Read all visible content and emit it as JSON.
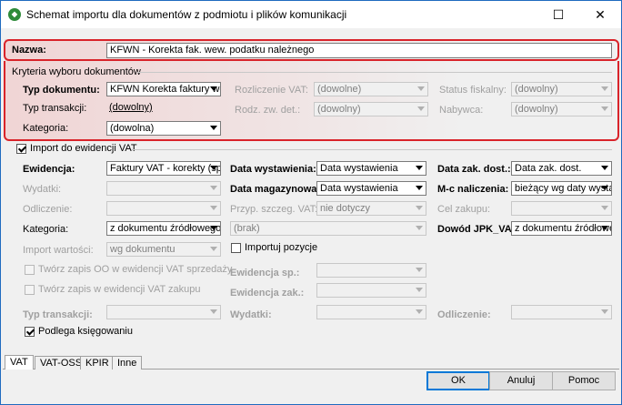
{
  "window": {
    "title": "Schemat importu dla dokumentów z podmiotu i plików komunikacji",
    "app_icon": "app-logo-icon"
  },
  "header": {
    "nazwa_label": "Nazwa:",
    "nazwa_value": "KFWN - Korekta fak. wew. podatku należnego"
  },
  "kryteria": {
    "section_label": "Kryteria wyboru dokumentów",
    "typ_dokumentu_label": "Typ dokumentu:",
    "typ_dokumentu_value": "KFWN Korekta faktury we",
    "typ_transakcji_label": "Typ transakcji:",
    "typ_transakcji_value": "(dowolny)",
    "kategoria_label": "Kategoria:",
    "kategoria_value": "(dowolna)",
    "rozliczenie_vat_label": "Rozliczenie VAT:",
    "rozliczenie_vat_value": "(dowolne)",
    "rodz_zw_det_label": "Rodz. zw. det.:",
    "rodz_zw_det_value": "(dowolny)",
    "status_fiskalny_label": "Status fiskalny:",
    "status_fiskalny_value": "(dowolny)",
    "nabywca_label": "Nabywca:",
    "nabywca_value": "(dowolny)"
  },
  "import_vat": {
    "checkbox_label": "Import do ewidencji VAT",
    "ewidencja_label": "Ewidencja:",
    "ewidencja_value": "Faktury VAT - korekty (sp",
    "wydatki_label": "Wydatki:",
    "odliczenie_label": "Odliczenie:",
    "kategoria_label": "Kategoria:",
    "kategoria_value": "z dokumentu źródłowego",
    "import_wartosci_label": "Import wartości:",
    "import_wartosci_value": "wg dokumentu",
    "data_wystawienia_label": "Data wystawienia:",
    "data_wystawienia_value": "Data wystawienia",
    "data_magazynowa_label": "Data magazynowa:",
    "data_magazynowa_value": "Data wystawienia",
    "przyp_szczeg_label": "Przyp. szczeg. VAT:",
    "przyp_szczeg_value": "nie dotyczy",
    "brak_value": "(brak)",
    "importuj_pozycje_label": "Importuj pozycje",
    "data_zak_dost_label": "Data zak. dost.:",
    "data_zak_dost_value": "Data zak. dost.",
    "mc_naliczenia_label": "M-c naliczenia:",
    "mc_naliczenia_value": "bieżący wg daty wysta",
    "cel_zakupu_label": "Cel zakupu:",
    "dowod_jpk_label": "Dowód JPK_VAT:",
    "dowod_jpk_value": "z dokumentu źródłowe",
    "tworz_sprzedazy_label": "Twórz zapis OO w ewidencji VAT sprzedaży",
    "tworz_zakupu_label": "Twórz zapis w ewidencji VAT zakupu",
    "ewidencja_sp_label": "Ewidencja sp.:",
    "ewidencja_zak_label": "Ewidencja zak.:",
    "typ_transakcji_label": "Typ transakcji:",
    "wydatki2_label": "Wydatki:",
    "odliczenie2_label": "Odliczenie:",
    "podlega_label": "Podlega księgowaniu"
  },
  "tabs": [
    "VAT",
    "VAT-OSS",
    "KPIR",
    "Inne"
  ],
  "buttons": {
    "ok": "OK",
    "anuluj": "Anuluj",
    "pomoc": "Pomoc"
  },
  "colors": {
    "highlight": "#d9232a",
    "window_border": "#1f6bbf"
  }
}
